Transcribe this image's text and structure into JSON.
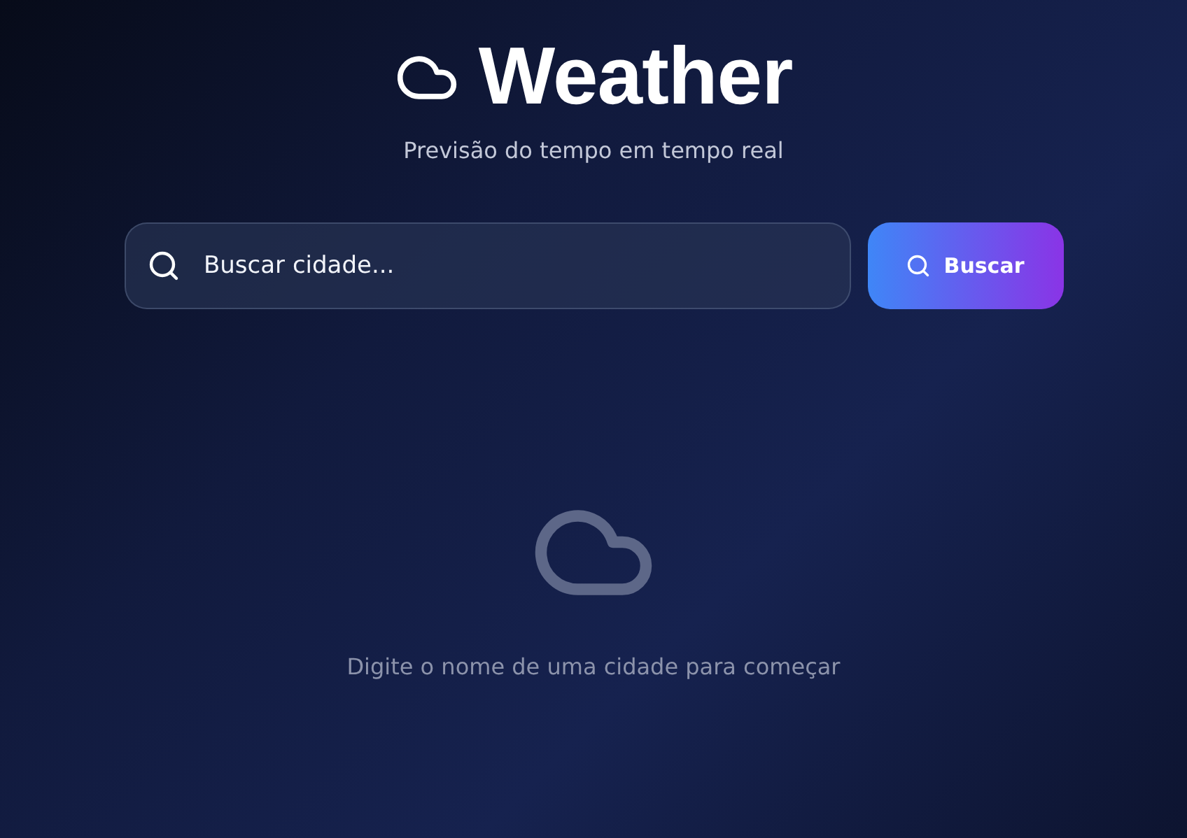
{
  "header": {
    "title": "Weather",
    "subtitle": "Previsão do tempo em tempo real"
  },
  "search": {
    "placeholder": "Buscar cidade...",
    "button": "Buscar"
  },
  "empty_state": {
    "message": "Digite o nome de uma cidade para começar"
  }
}
